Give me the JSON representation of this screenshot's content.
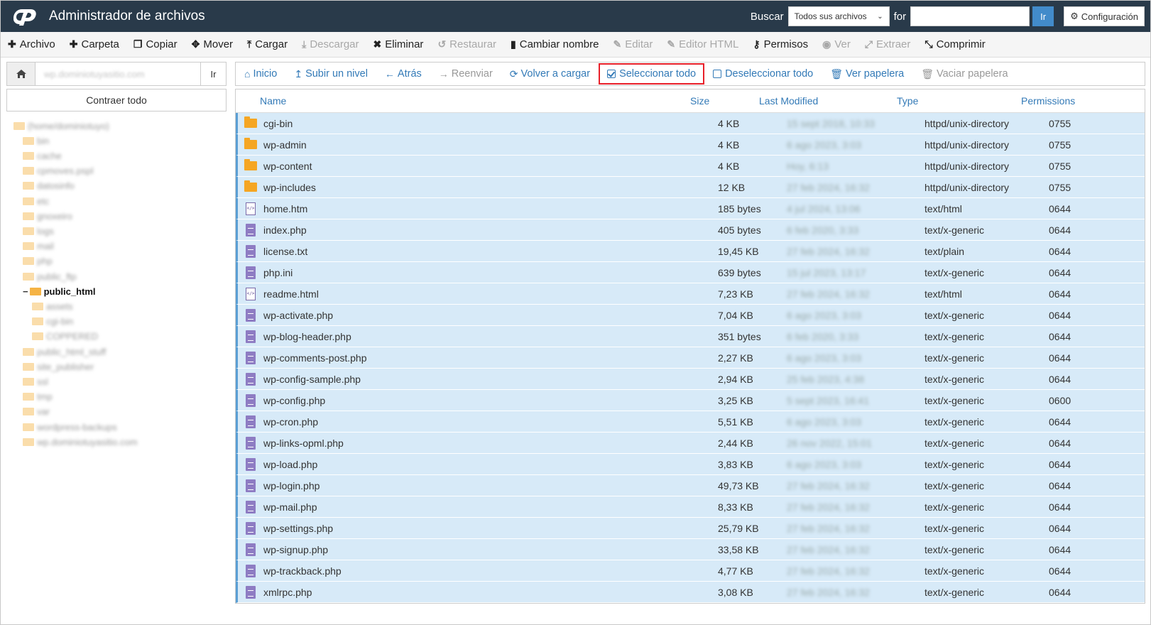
{
  "header": {
    "title": "Administrador de archivos",
    "search_label": "Buscar",
    "search_scope": "Todos sus archivos",
    "for_label": "for",
    "search_value": "",
    "go_label": "Ir",
    "config_label": "Configuración"
  },
  "toolbar": {
    "items": [
      {
        "label": "Archivo",
        "icon": "plus-icon",
        "glyph": "✚",
        "disabled": false
      },
      {
        "label": "Carpeta",
        "icon": "plus-icon",
        "glyph": "✚",
        "disabled": false
      },
      {
        "label": "Copiar",
        "icon": "copy-icon",
        "glyph": "❐",
        "disabled": false
      },
      {
        "label": "Mover",
        "icon": "move-icon",
        "glyph": "✥",
        "disabled": false
      },
      {
        "label": "Cargar",
        "icon": "upload-icon",
        "glyph": "⤒",
        "disabled": false
      },
      {
        "label": "Descargar",
        "icon": "download-icon",
        "glyph": "⤓",
        "disabled": true
      },
      {
        "label": "Eliminar",
        "icon": "delete-icon",
        "glyph": "✖",
        "disabled": false
      },
      {
        "label": "Restaurar",
        "icon": "restore-icon",
        "glyph": "↺",
        "disabled": true
      },
      {
        "label": "Cambiar nombre",
        "icon": "file-icon",
        "glyph": "▮",
        "disabled": false
      },
      {
        "label": "Editar",
        "icon": "pencil-icon",
        "glyph": "✎",
        "disabled": true
      },
      {
        "label": "Editor HTML",
        "icon": "edit-icon",
        "glyph": "✎",
        "disabled": true
      },
      {
        "label": "Permisos",
        "icon": "key-icon",
        "glyph": "⚷",
        "disabled": false
      },
      {
        "label": "Ver",
        "icon": "eye-icon",
        "glyph": "◉",
        "disabled": true
      },
      {
        "label": "Extraer",
        "icon": "expand-icon",
        "glyph": "⤢",
        "disabled": true
      },
      {
        "label": "Comprimir",
        "icon": "compress-icon",
        "glyph": "⤡",
        "disabled": false
      }
    ]
  },
  "left": {
    "path_value": "wp.dominiotuyasitio.com",
    "go_label": "Ir",
    "collapse_label": "Contraer todo",
    "tree": [
      {
        "label": "(home/dominiotuyo)",
        "level": 0,
        "current": false
      },
      {
        "label": "bin",
        "level": 1,
        "current": false
      },
      {
        "label": "cache",
        "level": 1,
        "current": false
      },
      {
        "label": "cpmoves.pspl",
        "level": 1,
        "current": false
      },
      {
        "label": "datosinfo",
        "level": 1,
        "current": false
      },
      {
        "label": "etc",
        "level": 1,
        "current": false
      },
      {
        "label": "gnoxeiro",
        "level": 1,
        "current": false
      },
      {
        "label": "logs",
        "level": 1,
        "current": false
      },
      {
        "label": "mail",
        "level": 1,
        "current": false
      },
      {
        "label": "php",
        "level": 1,
        "current": false
      },
      {
        "label": "public_ftp",
        "level": 1,
        "current": false
      },
      {
        "label": "public_html",
        "level": 1,
        "current": true
      },
      {
        "label": "assets",
        "level": 2,
        "current": false
      },
      {
        "label": "cgi-bin",
        "level": 2,
        "current": false
      },
      {
        "label": "COPPERED",
        "level": 2,
        "current": false
      },
      {
        "label": "public_html_stuff",
        "level": 1,
        "current": false
      },
      {
        "label": "site_publisher",
        "level": 1,
        "current": false
      },
      {
        "label": "ssl",
        "level": 1,
        "current": false
      },
      {
        "label": "tmp",
        "level": 1,
        "current": false
      },
      {
        "label": "var",
        "level": 1,
        "current": false
      },
      {
        "label": "wordpress-backups",
        "level": 1,
        "current": false
      },
      {
        "label": "wp.dominiotuyasitio.com",
        "level": 1,
        "current": false
      }
    ]
  },
  "nav": {
    "items": [
      {
        "label": "Inicio",
        "icon": "home-icon",
        "glyph": "⌂",
        "disabled": false,
        "highlight": false,
        "box": ""
      },
      {
        "label": "Subir un nivel",
        "icon": "level-up-icon",
        "glyph": "↥",
        "disabled": false,
        "highlight": false,
        "box": ""
      },
      {
        "label": "Atrás",
        "icon": "arrow-left-icon",
        "glyph": "←",
        "disabled": false,
        "highlight": false,
        "box": ""
      },
      {
        "label": "Reenviar",
        "icon": "arrow-right-icon",
        "glyph": "→",
        "disabled": true,
        "highlight": false,
        "box": ""
      },
      {
        "label": "Volver a cargar",
        "icon": "refresh-icon",
        "glyph": "⟳",
        "disabled": false,
        "highlight": false,
        "box": ""
      },
      {
        "label": "Seleccionar todo",
        "icon": "checkbox-checked-icon",
        "glyph": "",
        "disabled": false,
        "highlight": true,
        "box": "checked"
      },
      {
        "label": "Deseleccionar todo",
        "icon": "checkbox-empty-icon",
        "glyph": "",
        "disabled": false,
        "highlight": false,
        "box": "empty"
      },
      {
        "label": "Ver papelera",
        "icon": "trash-icon",
        "glyph": "🗑",
        "disabled": false,
        "highlight": false,
        "box": ""
      },
      {
        "label": "Vaciar papelera",
        "icon": "trash-icon",
        "glyph": "🗑",
        "disabled": true,
        "highlight": false,
        "box": ""
      }
    ]
  },
  "table": {
    "columns": {
      "name": "Name",
      "size": "Size",
      "modified": "Last Modified",
      "type": "Type",
      "permissions": "Permissions"
    },
    "rows": [
      {
        "icon": "folder",
        "name": "cgi-bin",
        "size": "4 KB",
        "modified": "15 sept 2018, 10:33",
        "type": "httpd/unix-directory",
        "perms": "0755"
      },
      {
        "icon": "folder",
        "name": "wp-admin",
        "size": "4 KB",
        "modified": "6 ago 2023, 3:03",
        "type": "httpd/unix-directory",
        "perms": "0755"
      },
      {
        "icon": "folder",
        "name": "wp-content",
        "size": "4 KB",
        "modified": "Hoy, 6:13",
        "type": "httpd/unix-directory",
        "perms": "0755"
      },
      {
        "icon": "folder",
        "name": "wp-includes",
        "size": "12 KB",
        "modified": "27 feb 2024, 16:32",
        "type": "httpd/unix-directory",
        "perms": "0755"
      },
      {
        "icon": "html",
        "name": "home.htm",
        "size": "185 bytes",
        "modified": "4 jul 2024, 13:06",
        "type": "text/html",
        "perms": "0644"
      },
      {
        "icon": "file",
        "name": "index.php",
        "size": "405 bytes",
        "modified": "6 feb 2020, 3:33",
        "type": "text/x-generic",
        "perms": "0644"
      },
      {
        "icon": "file",
        "name": "license.txt",
        "size": "19,45 KB",
        "modified": "27 feb 2024, 16:32",
        "type": "text/plain",
        "perms": "0644"
      },
      {
        "icon": "file",
        "name": "php.ini",
        "size": "639 bytes",
        "modified": "15 jul 2023, 13:17",
        "type": "text/x-generic",
        "perms": "0644"
      },
      {
        "icon": "html",
        "name": "readme.html",
        "size": "7,23 KB",
        "modified": "27 feb 2024, 16:32",
        "type": "text/html",
        "perms": "0644"
      },
      {
        "icon": "file",
        "name": "wp-activate.php",
        "size": "7,04 KB",
        "modified": "6 ago 2023, 3:03",
        "type": "text/x-generic",
        "perms": "0644"
      },
      {
        "icon": "file",
        "name": "wp-blog-header.php",
        "size": "351 bytes",
        "modified": "6 feb 2020, 3:33",
        "type": "text/x-generic",
        "perms": "0644"
      },
      {
        "icon": "file",
        "name": "wp-comments-post.php",
        "size": "2,27 KB",
        "modified": "6 ago 2023, 3:03",
        "type": "text/x-generic",
        "perms": "0644"
      },
      {
        "icon": "file",
        "name": "wp-config-sample.php",
        "size": "2,94 KB",
        "modified": "25 feb 2023, 4:38",
        "type": "text/x-generic",
        "perms": "0644"
      },
      {
        "icon": "file",
        "name": "wp-config.php",
        "size": "3,25 KB",
        "modified": "5 sept 2023, 16:41",
        "type": "text/x-generic",
        "perms": "0600"
      },
      {
        "icon": "file",
        "name": "wp-cron.php",
        "size": "5,51 KB",
        "modified": "6 ago 2023, 3:03",
        "type": "text/x-generic",
        "perms": "0644"
      },
      {
        "icon": "file",
        "name": "wp-links-opml.php",
        "size": "2,44 KB",
        "modified": "26 nov 2022, 15:01",
        "type": "text/x-generic",
        "perms": "0644"
      },
      {
        "icon": "file",
        "name": "wp-load.php",
        "size": "3,83 KB",
        "modified": "6 ago 2023, 3:03",
        "type": "text/x-generic",
        "perms": "0644"
      },
      {
        "icon": "file",
        "name": "wp-login.php",
        "size": "49,73 KB",
        "modified": "27 feb 2024, 16:32",
        "type": "text/x-generic",
        "perms": "0644"
      },
      {
        "icon": "file",
        "name": "wp-mail.php",
        "size": "8,33 KB",
        "modified": "27 feb 2024, 16:32",
        "type": "text/x-generic",
        "perms": "0644"
      },
      {
        "icon": "file",
        "name": "wp-settings.php",
        "size": "25,79 KB",
        "modified": "27 feb 2024, 16:32",
        "type": "text/x-generic",
        "perms": "0644"
      },
      {
        "icon": "file",
        "name": "wp-signup.php",
        "size": "33,58 KB",
        "modified": "27 feb 2024, 16:32",
        "type": "text/x-generic",
        "perms": "0644"
      },
      {
        "icon": "file",
        "name": "wp-trackback.php",
        "size": "4,77 KB",
        "modified": "27 feb 2024, 16:32",
        "type": "text/x-generic",
        "perms": "0644"
      },
      {
        "icon": "file",
        "name": "xmlrpc.php",
        "size": "3,08 KB",
        "modified": "27 feb 2024, 16:32",
        "type": "text/x-generic",
        "perms": "0644"
      }
    ]
  },
  "colors": {
    "header_bg": "#293a4a",
    "link": "#337ab7",
    "selected_row": "#d7eaf8",
    "highlight_border": "#e8202a",
    "folder": "#f5a623",
    "file": "#8e7cc3"
  }
}
